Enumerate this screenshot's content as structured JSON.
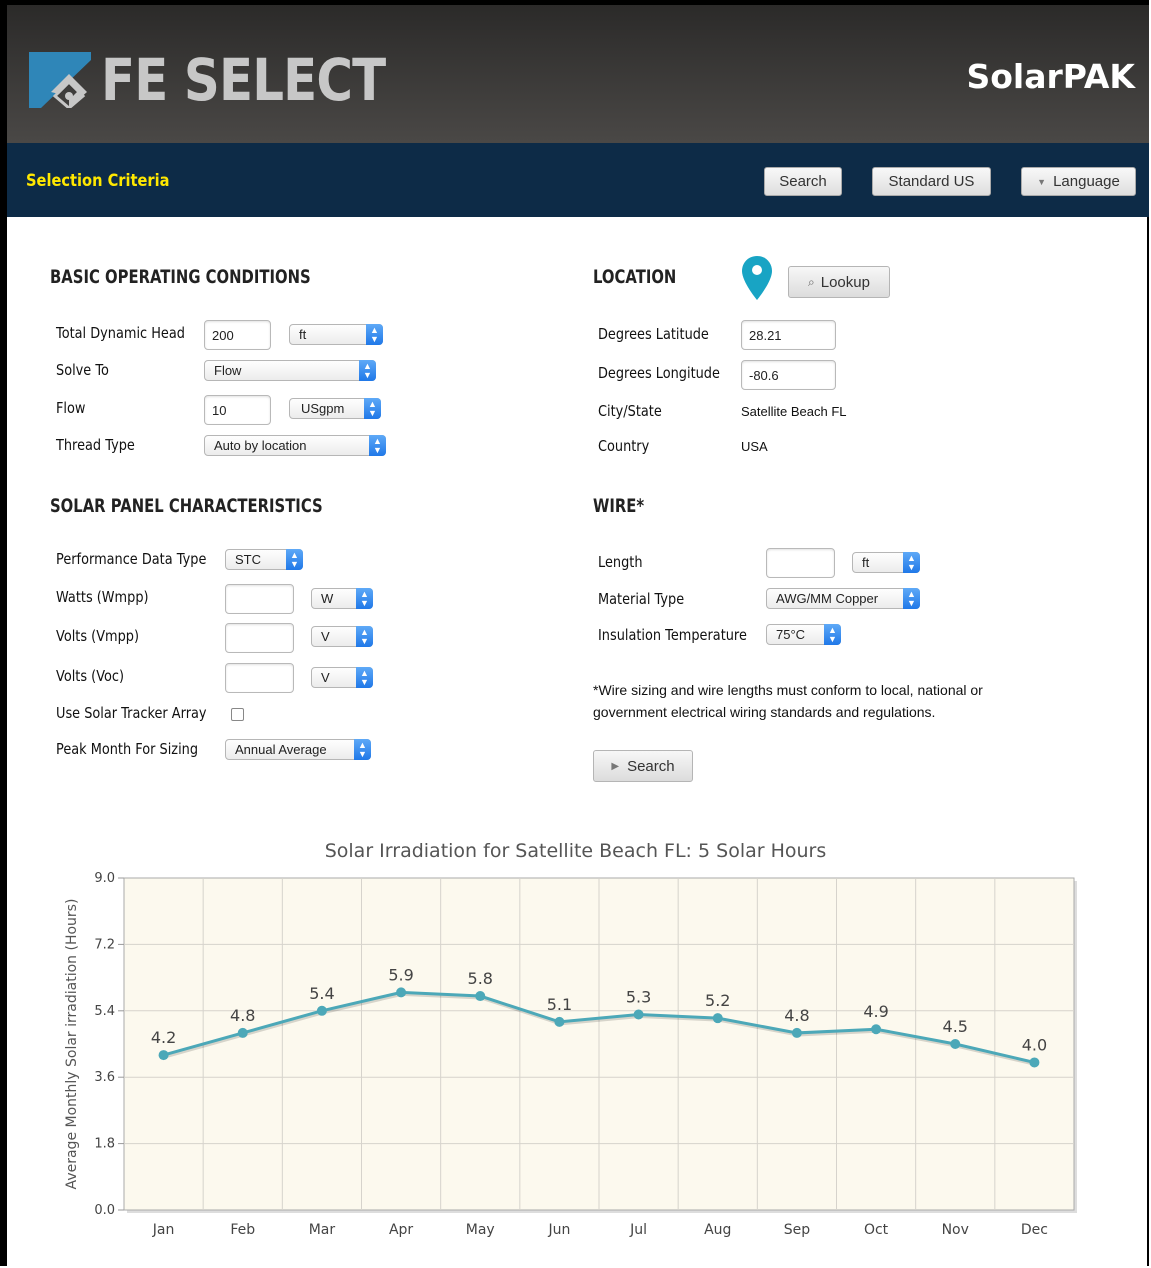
{
  "header": {
    "logo_text": "FE SELECT",
    "brand": "SolarPAK"
  },
  "nav": {
    "title": "Selection Criteria",
    "search_label": "Search",
    "units_label": "Standard US",
    "language_label": "Language"
  },
  "basic": {
    "heading": "BASIC OPERATING CONDITIONS",
    "tdh_label": "Total Dynamic Head",
    "tdh_value": "200",
    "tdh_unit": "ft",
    "solve_label": "Solve To",
    "solve_value": "Flow",
    "flow_label": "Flow",
    "flow_value": "10",
    "flow_unit": "USgpm",
    "thread_label": "Thread Type",
    "thread_value": "Auto by location"
  },
  "solar": {
    "heading": "SOLAR PANEL CHARACTERISTICS",
    "perf_label": "Performance Data Type",
    "perf_value": "STC",
    "watts_label": "Watts (Wmpp)",
    "watts_unit": "W",
    "vmpp_label": "Volts (Vmpp)",
    "vmpp_unit": "V",
    "voc_label": "Volts (Voc)",
    "voc_unit": "V",
    "tracker_label": "Use Solar Tracker Array",
    "peak_label": "Peak Month For Sizing",
    "peak_value": "Annual Average"
  },
  "location": {
    "heading": "LOCATION",
    "lookup_label": "Lookup",
    "lat_label": "Degrees Latitude",
    "lat_value": "28.21",
    "lon_label": "Degrees Longitude",
    "lon_value": "-80.6",
    "city_label": "City/State",
    "city_value": "Satellite Beach FL",
    "country_label": "Country",
    "country_value": "USA"
  },
  "wire": {
    "heading": "WIRE*",
    "length_label": "Length",
    "length_unit": "ft",
    "material_label": "Material Type",
    "material_value": "AWG/MM Copper",
    "insulation_label": "Insulation Temperature",
    "insulation_value": "75°C",
    "note": "*Wire sizing and wire lengths must conform to local, national or government electrical wiring standards and regulations.",
    "search_label": "Search"
  },
  "colors": {
    "line": "#4ca8b8",
    "plot_bg": "#fcf9ee",
    "nav_bg": "#0d2b47",
    "nav_title": "#ffe800",
    "pin": "#18a4c4"
  },
  "chart_data": {
    "type": "line",
    "title": "Solar Irradiation for Satellite Beach FL: 5 Solar Hours",
    "ylabel": "Average Monthly Solar irradiation (Hours)",
    "xlabel": "",
    "ylim": [
      0,
      9
    ],
    "yticks": [
      "0.0",
      "1.8",
      "3.6",
      "5.4",
      "7.2",
      "9.0"
    ],
    "categories": [
      "Jan",
      "Feb",
      "Mar",
      "Apr",
      "May",
      "Jun",
      "Jul",
      "Aug",
      "Sep",
      "Oct",
      "Nov",
      "Dec"
    ],
    "values": [
      4.2,
      4.8,
      5.4,
      5.9,
      5.8,
      5.1,
      5.3,
      5.2,
      4.8,
      4.9,
      4.5,
      4.0
    ],
    "data_labels": [
      "4.2",
      "4.8",
      "5.4",
      "5.9",
      "5.8",
      "5.1",
      "5.3",
      "5.2",
      "4.8",
      "4.9",
      "4.5",
      "4.0"
    ],
    "grid": true
  }
}
